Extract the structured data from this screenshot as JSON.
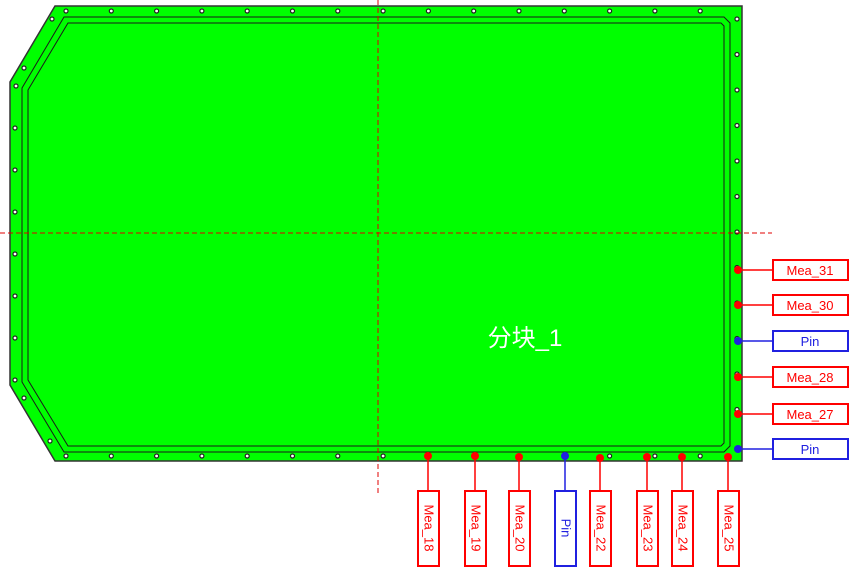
{
  "panel": {
    "label": "分块_1",
    "fill_color": "#00ff00",
    "label_color": "#ffffff"
  },
  "colors": {
    "measure": "#ff0000",
    "pin": "#2020e0",
    "crosshair": "#e00000",
    "outline": "#1a1a1a"
  },
  "right_markers": [
    {
      "label": "Mea_31",
      "kind": "measure"
    },
    {
      "label": "Mea_30",
      "kind": "measure"
    },
    {
      "label": "Pin",
      "kind": "pin"
    },
    {
      "label": "Mea_28",
      "kind": "measure"
    },
    {
      "label": "Mea_27",
      "kind": "measure"
    },
    {
      "label": "Pin",
      "kind": "pin"
    }
  ],
  "bottom_markers": [
    {
      "label": "Mea_18",
      "kind": "measure"
    },
    {
      "label": "Mea_19",
      "kind": "measure"
    },
    {
      "label": "Mea_20",
      "kind": "measure"
    },
    {
      "label": "Pin",
      "kind": "pin"
    },
    {
      "label": "Mea_22",
      "kind": "measure"
    },
    {
      "label": "Mea_23",
      "kind": "measure"
    },
    {
      "label": "Mea_24",
      "kind": "measure"
    },
    {
      "label": "Mea_25",
      "kind": "measure"
    }
  ]
}
